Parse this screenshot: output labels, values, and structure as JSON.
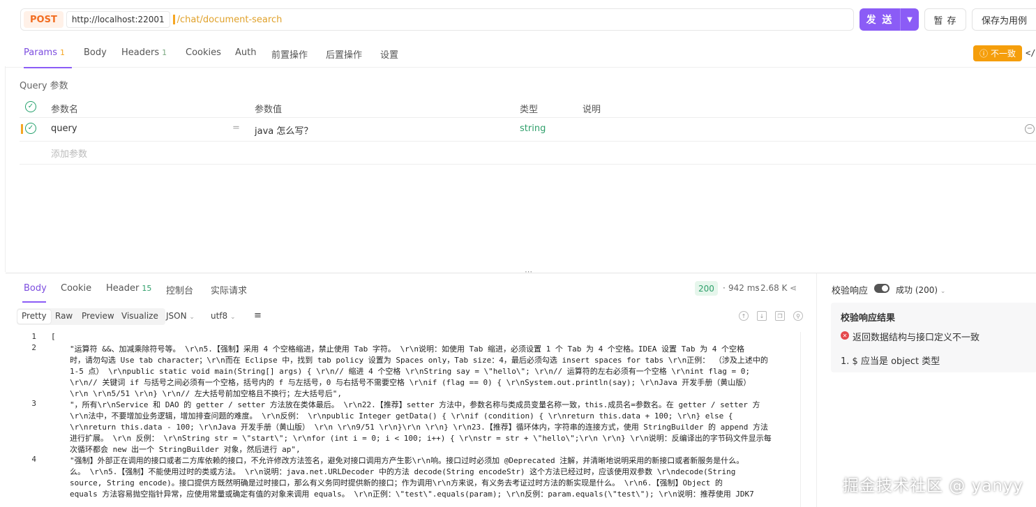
{
  "request": {
    "method": "POST",
    "host": "http://localhost:22001",
    "path": "/chat/document-search",
    "send_label": "发 送",
    "save_label": "暂 存",
    "save_as_label": "保存为用例"
  },
  "req_tabs": [
    {
      "label": "Params",
      "count": "1"
    },
    {
      "label": "Body",
      "count": ""
    },
    {
      "label": "Headers",
      "count": "1"
    },
    {
      "label": "Cookies",
      "count": ""
    },
    {
      "label": "Auth",
      "count": ""
    },
    {
      "label": "前置操作",
      "count": ""
    },
    {
      "label": "后置操作",
      "count": ""
    },
    {
      "label": "设置",
      "count": ""
    }
  ],
  "mismatch_badge": "不一致",
  "code_toggle_icon": "</>",
  "query": {
    "title": "Query 参数",
    "headers": {
      "name": "参数名",
      "value": "参数值",
      "type": "类型",
      "desc": "说明"
    },
    "rows": [
      {
        "name": "query",
        "value": "java 怎么写？",
        "type": "string",
        "desc": ""
      }
    ],
    "add_placeholder": "添加参数"
  },
  "response": {
    "tabs": [
      {
        "label": "Body",
        "count": ""
      },
      {
        "label": "Cookie",
        "count": ""
      },
      {
        "label": "Header",
        "count": "15"
      },
      {
        "label": "控制台",
        "count": ""
      },
      {
        "label": "实际请求",
        "count": ""
      }
    ],
    "status": "200",
    "time": "942 ms",
    "size": "2.68 K",
    "formats": [
      "Pretty",
      "Raw",
      "Preview",
      "Visualize"
    ],
    "lang": "JSON",
    "encoding": "utf8",
    "line_numbers": [
      "1",
      "2",
      "3",
      "4"
    ],
    "code_lines": [
      "[",
      "\"运算符 &&、加减乘除符号等。 \\r\\n5.【强制】采用 4 个空格缩进，禁止使用 Tab 字符。 \\r\\n说明：如使用 Tab 缩进，必须设置 1 个 Tab 为 4 个空格。IDEA 设置 Tab 为 4 个空格",
      "时，请勿勾选 Use tab character；\\r\\n而在 Eclipse 中，找到 tab policy 设置为 Spaces only，Tab size：4，最后必须勾选 insert spaces for tabs \\r\\n正例： （涉及上述中的",
      "1-5 点） \\r\\npublic static void main(String[] args) { \\r\\n// 缩进 4 个空格 \\r\\nString say = \\\"hello\\\"; \\r\\n// 运算符的左右必须有一个空格 \\r\\nint flag = 0;",
      "\\r\\n// 关键词 if 与括号之间必须有一个空格，括号内的 f 与左括号，0 与右括号不需要空格 \\r\\nif (flag == 0) { \\r\\nSystem.out.println(say); \\r\\nJava 开发手册（黄山版）",
      "\\r\\n \\r\\n5/51 \\r\\n} \\r\\n// 左大括号前加空格且不换行；左大括号后\",",
      "\"，所有\\r\\nService 和 DAO 的 getter / setter 方法放在类体最后。 \\r\\n22.【推荐】setter 方法中，参数名称与类成员变量名称一致，this.成员名=参数名。在 getter / setter 方",
      "\\r\\n法中，不要增加业务逻辑，增加排查问题的难度。 \\r\\n反例： \\r\\npublic Integer getData() { \\r\\nif (condition) { \\r\\nreturn this.data + 100; \\r\\n} else {",
      "\\r\\nreturn this.data - 100; \\r\\nJava 开发手册（黄山版） \\r\\n \\r\\n9/51 \\r\\n}\\r\\n \\r\\n} \\r\\n23.【推荐】循环体内，字符串的连接方式，使用 StringBuilder 的 append 方法",
      "进行扩展。 \\r\\n 反例： \\r\\nString str = \\\"start\\\"; \\r\\nfor (int i = 0; i < 100; i++) { \\r\\nstr = str + \\\"hello\\\";\\r\\n \\r\\n} \\r\\n说明：反编译出的字节码文件显示每",
      "次循环都会 new 出一个 StringBuilder 对象，然后进行 ap\",",
      "\"强制】外部正在调用的接口或者二方库依赖的接口，不允许修改方法签名，避免对接口调用方产生影\\r\\n响。接口过时必须加 @Deprecated 注解，并清晰地说明采用的新接口或者新服务是什么。",
      "么。 \\r\\n5.【强制】不能使用过时的类或方法。 \\r\\n说明：java.net.URLDecoder 中的方法 decode(String encodeStr) 这个方法已经过时，应该使用双参数 \\r\\ndecode(String",
      "source, String encode)。接口提供方既然明确是过时接口，那么有义务同时提供新的接口；作为调用\\r\\n方来说，有义务去考证过时方法的新实现是什么。 \\r\\n6.【强制】Object 的",
      "equals 方法容易抛空指针异常，应使用常量或确定有值的对象来调用 equals。 \\r\\n正例：\\\"test\\\".equals(param); \\r\\n反例：param.equals(\\\"test\\\"); \\r\\n说明：推荐使用 JDK7"
    ]
  },
  "validation": {
    "label": "校验响应",
    "select": "成功 (200)",
    "result_title": "校验响应结果",
    "error": "返回数据结构与接口定义不一致",
    "detail": "1. $ 应当是 object 类型"
  },
  "watermark": "掘金技术社区 @ yanyy"
}
